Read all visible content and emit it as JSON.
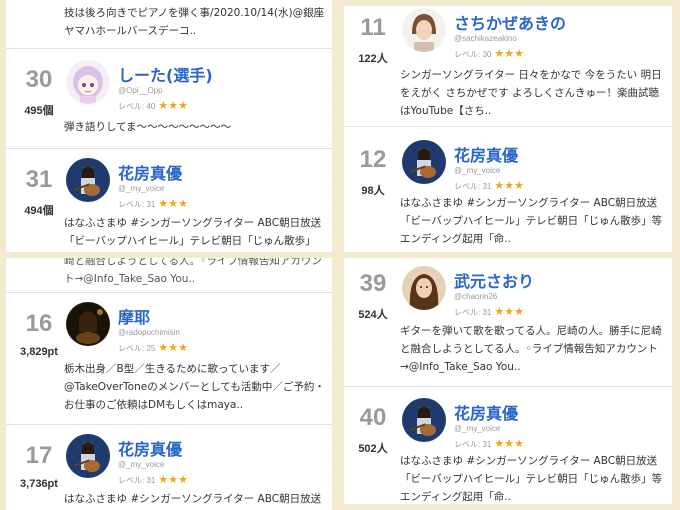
{
  "panels": {
    "top_left": {
      "partial_bio": "技は後ろ向きでピアノを弾く事/2020.10/14(水)@銀座ヤマハホールバースデーコ..",
      "entries": [
        {
          "rank": "30",
          "count": "495個",
          "name": "しーた(選手)",
          "id": "@Opi__Opp",
          "level": "レベル: 40",
          "stars": "★★★",
          "bio": "弾き語りしてま〜〜〜〜〜〜〜〜〜"
        },
        {
          "rank": "31",
          "count": "494個",
          "name": "花房真優",
          "id": "@_my_voice",
          "level": "レベル: 31",
          "stars": "★★★",
          "bio": "はなふさまゆ #シンガーソングライター ABC朝日放送「ビーバップハイヒール」テレビ朝日「じゅん散歩」"
        }
      ]
    },
    "top_right": {
      "entries": [
        {
          "rank": "11",
          "count": "122人",
          "name": "さちかぜあきの",
          "id": "@sachikazeakino",
          "level": "レベル: 30",
          "stars": "★★★",
          "bio": "シンガーソングライター 日々をかなで 今をうたい 明日をえがく さちかぜです よろしくさんきゅー！楽曲試聴はYouTube【さち.."
        },
        {
          "rank": "12",
          "count": "98人",
          "name": "花房真優",
          "id": "@_my_voice",
          "level": "レベル: 31",
          "stars": "★★★",
          "bio": "はなふさまゆ #シンガーソングライター ABC朝日放送「ビーバップハイヒール」テレビ朝日「じゅん散歩」等エンディング起用「命.."
        }
      ]
    },
    "bottom_left": {
      "partial_bio": "崎と融合しようとしてる人。◦ライブ情報告知アカウント→@Info_Take_Sao You..",
      "entries": [
        {
          "rank": "16",
          "count": "3,829pt",
          "name": "摩耶",
          "id": "@radopuchimisin",
          "level": "レベル: 25",
          "stars": "★★★",
          "bio": "栃木出身／B型／生きるために歌っています／@TakeOverToneのメンバーとしても活動中／ご予約・お仕事のご依頼はDMもしくはmaya.."
        },
        {
          "rank": "17",
          "count": "3,736pt",
          "name": "花房真優",
          "id": "@_my_voice",
          "level": "レベル: 31",
          "stars": "★★★",
          "bio": "はなふさまゆ #シンガーソングライター ABC朝日放送"
        }
      ]
    },
    "bottom_right": {
      "entries": [
        {
          "rank": "39",
          "count": "524人",
          "name": "武元さおり",
          "id": "@chaorin26",
          "level": "レベル: 31",
          "stars": "★★★",
          "bio": "ギターを弾いて歌を歌ってる人。尼崎の人。勝手に尼崎と融合しようとしてる人。◦ライブ情報告知アカウント→@Info_Take_Sao You.."
        },
        {
          "rank": "40",
          "count": "502人",
          "name": "花房真優",
          "id": "@_my_voice",
          "level": "レベル: 31",
          "stars": "★★★",
          "bio": "はなふさまゆ #シンガーソングライター ABC朝日放送「ビーバップハイヒール」テレビ朝日「じゅん散歩」等エンディング起用「命.."
        }
      ]
    }
  }
}
